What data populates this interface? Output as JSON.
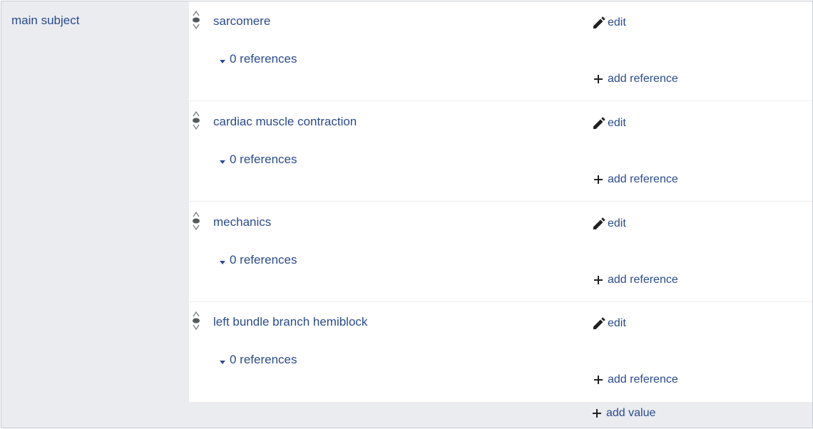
{
  "property": {
    "label": "main subject"
  },
  "statements": [
    {
      "value": "sarcomere",
      "edit_label": "edit",
      "references_label": "0 references",
      "add_reference_label": "add reference"
    },
    {
      "value": "cardiac muscle contraction",
      "edit_label": "edit",
      "references_label": "0 references",
      "add_reference_label": "add reference"
    },
    {
      "value": "mechanics",
      "edit_label": "edit",
      "references_label": "0 references",
      "add_reference_label": "add reference"
    },
    {
      "value": "left bundle branch hemiblock",
      "edit_label": "edit",
      "references_label": "0 references",
      "add_reference_label": "add reference"
    }
  ],
  "footer": {
    "add_value_label": "add value"
  },
  "colors": {
    "link": "#2a4b8d",
    "group_background": "#eaecf0",
    "border": "#c8ccd1",
    "icon": "#202122"
  },
  "icons": {
    "rank": "rank-normal-icon",
    "edit": "pencil-icon",
    "expand": "caret-down-icon",
    "add": "plus-icon"
  }
}
